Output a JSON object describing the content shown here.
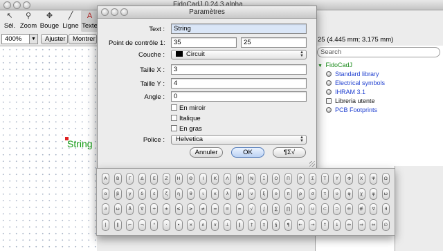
{
  "main_window": {
    "title": "FidoCadJ 0.24.3 alpha",
    "toolbar": [
      {
        "label": "Sél.",
        "icon": "arrow-pointer-icon",
        "glyph": "↖"
      },
      {
        "label": "Zoom",
        "icon": "magnifier-icon",
        "glyph": "⚲"
      },
      {
        "label": "Bouge",
        "icon": "move-cross-icon",
        "glyph": "✥"
      },
      {
        "label": "Ligne",
        "icon": "line-icon",
        "glyph": "╱"
      },
      {
        "label": "Texte",
        "icon": "text-tool-icon",
        "glyph": "A"
      }
    ],
    "zoom_value": "400%",
    "fit_button": "Ajuster",
    "show_button": "Montrer l",
    "coordinates": "25 (4.445 mm; 3.175 mm)",
    "canvas_text": "String"
  },
  "library": {
    "search_placeholder": "Search",
    "root": "FidoCadJ",
    "items": [
      "Standard library",
      "Electrical symbols",
      "IHRAM 3.1",
      "Libreria utente",
      "PCB Footprints"
    ]
  },
  "dialog": {
    "title": "Paramètres",
    "text_label": "Text :",
    "text_value": "String",
    "control_point_label": "Point de contrôle 1:",
    "control_x": "35",
    "control_y": "25",
    "layer_label": "Couche :",
    "layer_value": "Circuit",
    "size_x_label": "Taille X :",
    "size_x_value": "3",
    "size_y_label": "Taille Y :",
    "size_y_value": "4",
    "angle_label": "Angle :",
    "angle_value": "0",
    "mirror_label": "En miroir",
    "italic_label": "Italique",
    "bold_label": "En gras",
    "font_label": "Police :",
    "font_value": "Helvetica",
    "cancel_button": "Annuler",
    "ok_button": "OK",
    "symbols_button": "¶Σ√"
  },
  "palette": {
    "rows": [
      [
        "Α",
        "Β",
        "Γ",
        "Δ",
        "Ε",
        "Ζ",
        "Η",
        "Θ",
        "Ι",
        "Κ",
        "Λ",
        "Μ",
        "Ν",
        "Ξ",
        "Ο",
        "Π",
        "Ρ",
        "Σ",
        "Τ",
        "Υ",
        "Φ",
        "Χ",
        "Ψ",
        "Ω"
      ],
      [
        "α",
        "β",
        "γ",
        "δ",
        "ε",
        "ζ",
        "η",
        "θ",
        "ι",
        "κ",
        "λ",
        "μ",
        "ν",
        "ξ",
        "ο",
        "π",
        "ρ",
        "σ",
        "τ",
        "υ",
        "φ",
        "χ",
        "ψ",
        "ω"
      ],
      [
        "∂",
        "ω",
        "Å",
        "∇",
        "÷",
        "±",
        "≤",
        "≥",
        "≠",
        "≈",
        "≡",
        "∞",
        "√",
        "∫",
        "∑",
        "∏",
        "∩",
        "∪",
        "⊂",
        "⊃",
        "∈",
        "∉",
        "∀",
        "∃"
      ],
      [
        "|",
        "‖",
        "⌐",
        "¬",
        "°",
        "·",
        "•",
        "×",
        "∧",
        "∨",
        "⊥",
        "∥",
        "†",
        "‡",
        "§",
        "¶",
        "←",
        "→",
        "↑",
        "↓",
        "↔",
        "⇒",
        "⇔",
        "∅"
      ]
    ]
  }
}
